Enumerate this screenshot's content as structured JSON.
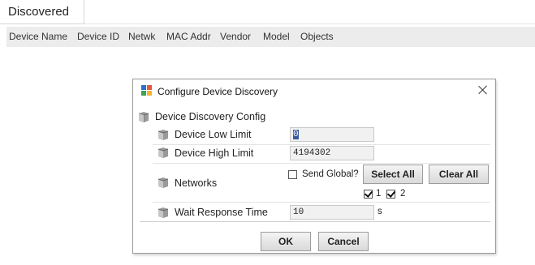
{
  "tab": {
    "label": "Discovered"
  },
  "columns": [
    "Device Name",
    "Device ID",
    "Netwk",
    "MAC Addr",
    "Vendor",
    "Model",
    "Objects"
  ],
  "dialog": {
    "title": "Configure Device Discovery",
    "section": "Device Discovery Config",
    "device_low_limit": {
      "label": "Device Low Limit",
      "value": "0"
    },
    "device_high_limit": {
      "label": "Device High Limit",
      "value": "4194302"
    },
    "networks": {
      "label": "Networks",
      "send_global_label": "Send Global?",
      "send_global_checked": false,
      "select_all": "Select All",
      "clear_all": "Clear All",
      "items": [
        {
          "label": "1",
          "checked": true
        },
        {
          "label": "2",
          "checked": true
        }
      ]
    },
    "wait_response_time": {
      "label": "Wait Response Time",
      "value": "10",
      "unit": "s"
    },
    "ok": "OK",
    "cancel": "Cancel"
  },
  "colors": {
    "header_bg": "#ececec",
    "field_bg": "#f1f1f1",
    "selection": "#3a5a9e"
  },
  "icons": [
    "bacnet-app-icon",
    "property-sheet-icon",
    "close-icon",
    "check-icon"
  ]
}
